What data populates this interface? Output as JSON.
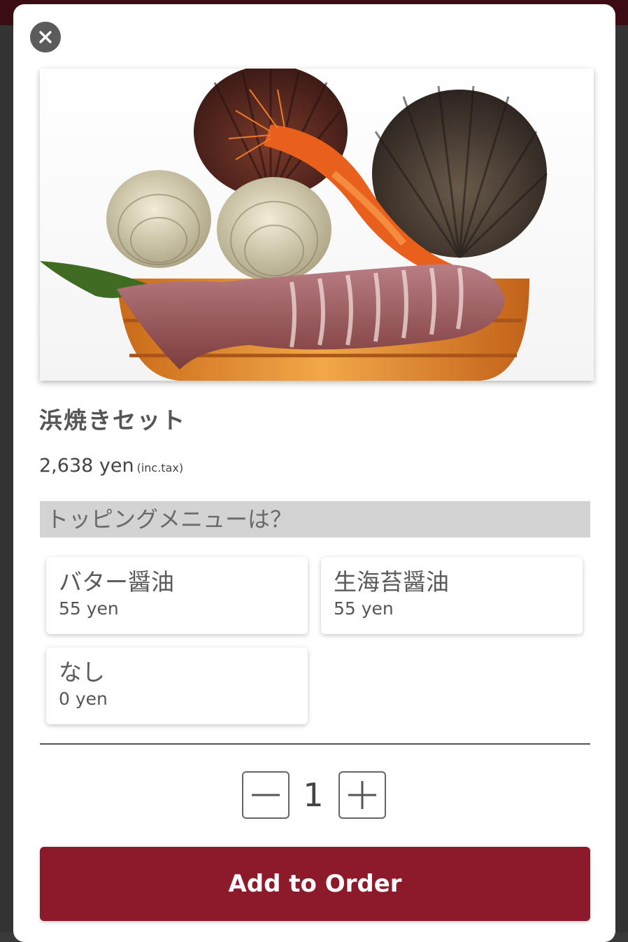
{
  "modal": {
    "close_icon": "close-icon"
  },
  "item": {
    "image_icon": "seafood-photo",
    "name": "浜焼きセット",
    "price": "2,638 yen",
    "tax_note": "(inc.tax)"
  },
  "topping": {
    "heading": "トッピングメニューは？",
    "options": [
      {
        "name": "バター醤油",
        "price": "55 yen"
      },
      {
        "name": "生海苔醤油",
        "price": "55 yen"
      },
      {
        "name": "なし",
        "price": "0 yen"
      }
    ]
  },
  "quantity": {
    "value": "1",
    "minus_icon": "minus-icon",
    "plus_icon": "plus-icon"
  },
  "actions": {
    "add_label": "Add to Order"
  },
  "colors": {
    "accent": "#8d1a2a",
    "header_bg": "#d3d3d3",
    "backdrop_top": "#3b0d12"
  }
}
